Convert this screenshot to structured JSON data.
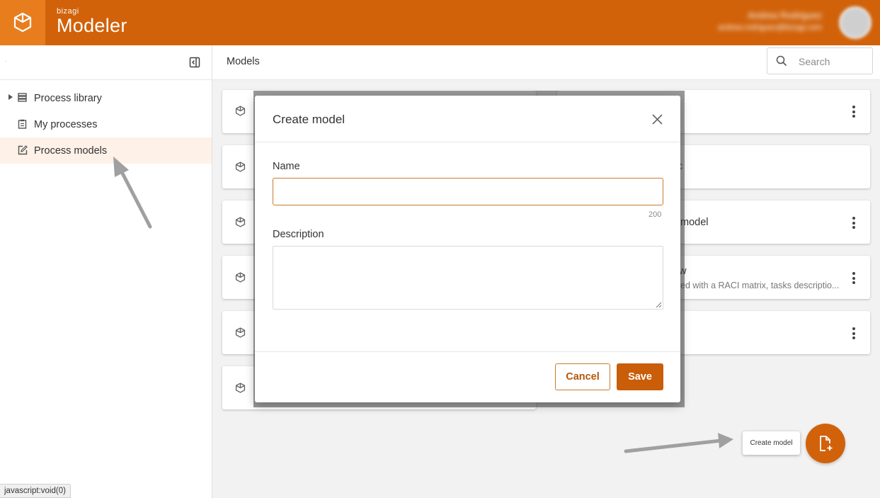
{
  "header": {
    "brand_small": "bizagi",
    "brand_title": "Modeler",
    "user_name": "Andrea Rodriguez",
    "user_email": "andrea.rodriguez@bizagi.com"
  },
  "sidebar": {
    "items": [
      {
        "label": "Process library",
        "icon": "stack-icon",
        "has_caret": true
      },
      {
        "label": "My processes",
        "icon": "clipboard-icon"
      },
      {
        "label": "Process models",
        "icon": "edit-doc-icon",
        "active": true
      }
    ]
  },
  "topbar": {
    "title": "Models",
    "search_placeholder": "Search"
  },
  "cards_right_visible": [
    {
      "text": ""
    },
    {
      "text": "c"
    },
    {
      "text": "model"
    },
    {
      "text": "w",
      "sub": "ed with a RACI matrix, tasks descriptio..."
    },
    {
      "text": ""
    }
  ],
  "modal": {
    "title": "Create model",
    "name_label": "Name",
    "name_value": "",
    "name_counter": "200",
    "description_label": "Description",
    "description_value": "",
    "cancel_label": "Cancel",
    "save_label": "Save"
  },
  "fab": {
    "tooltip": "Create model"
  },
  "status_bar": {
    "url": "javascript:void(0)"
  },
  "colors": {
    "brand_orange": "#d1620a",
    "logo_orange": "#e87d1e",
    "active_nav_bg": "#fdf1e8",
    "annotation_arrow": "#a0a0a0"
  }
}
